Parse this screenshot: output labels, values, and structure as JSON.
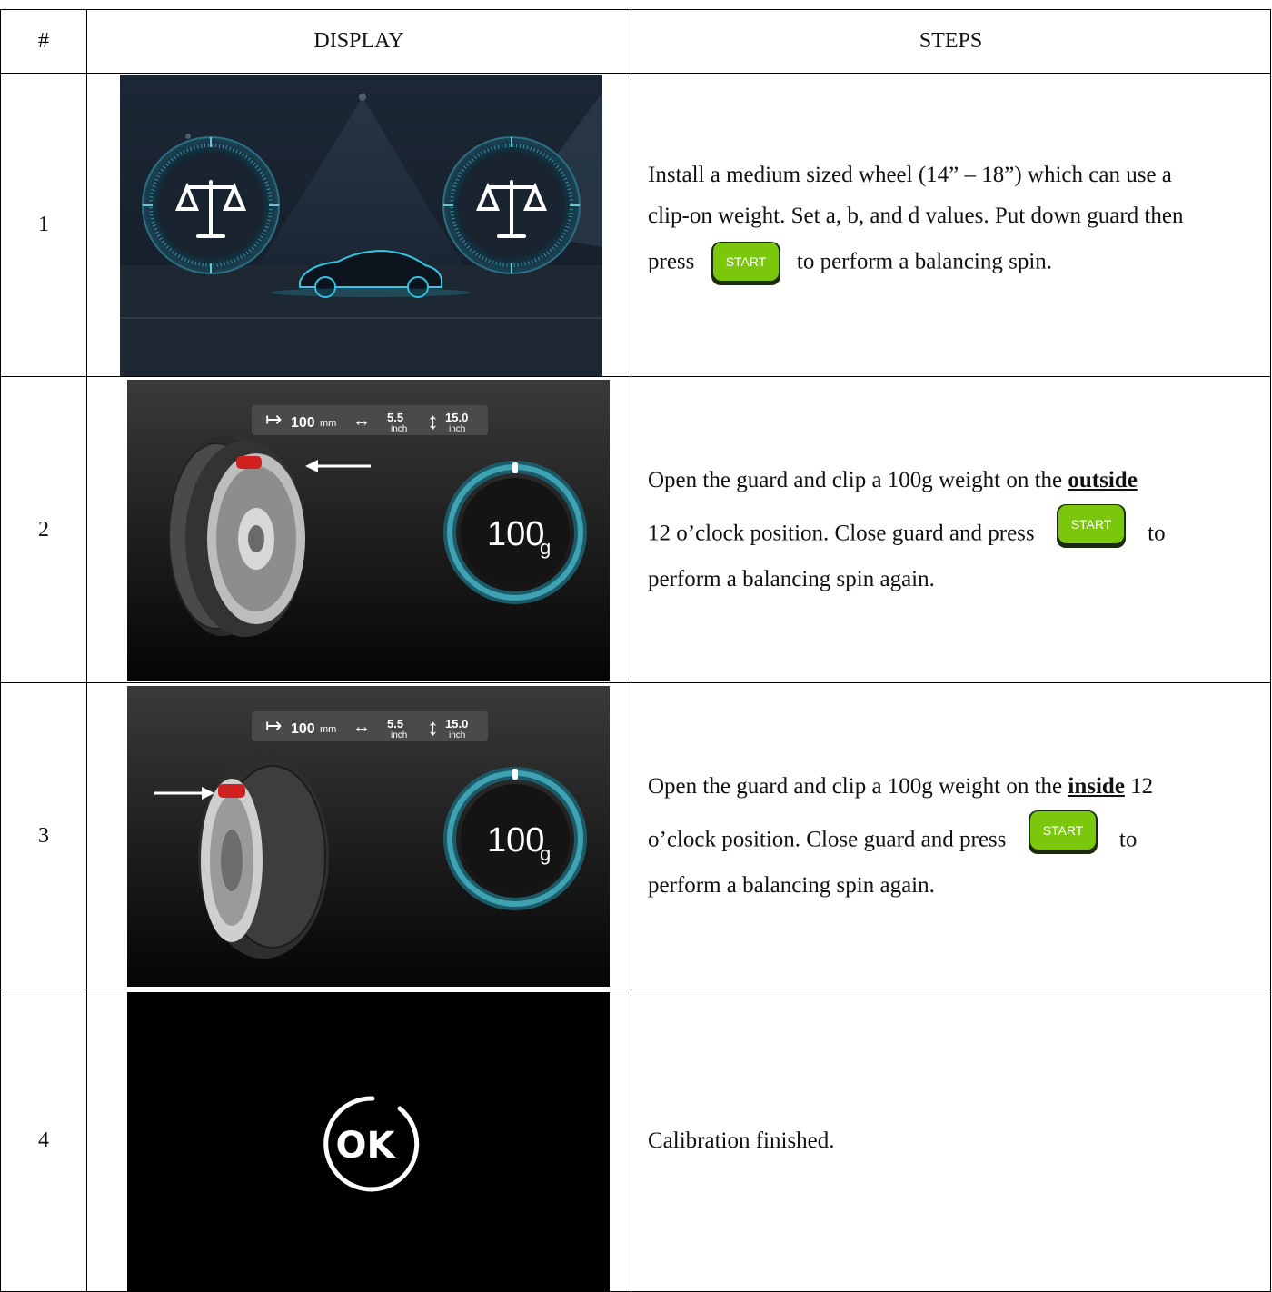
{
  "table": {
    "headers": [
      "#",
      "DISPLAY",
      "STEPS"
    ],
    "rows": [
      {
        "num": "1",
        "steps": {
          "line1": "Install a medium sized wheel (14” – 18”) which can use a",
          "line2": "clip-on weight. Set a, b, and d values. Put down guard then",
          "line3_pre": "press",
          "line3_post": "to perform a balancing spin."
        }
      },
      {
        "num": "2",
        "display": {
          "dim_a": "100",
          "dim_a_unit": "mm",
          "dim_b": "5.5",
          "dim_b_unit": "inch",
          "dim_d": "15.0",
          "dim_d_unit": "inch",
          "weight": "100",
          "weight_unit": "g"
        },
        "steps": {
          "line1_pre": "Open the guard and clip a 100g weight on the ",
          "line1_em": "outside",
          "line2_pre": "12 o’clock position. Close guard and press",
          "line2_post": "to",
          "line3": "perform a balancing spin again."
        }
      },
      {
        "num": "3",
        "display": {
          "dim_a": "100",
          "dim_a_unit": "mm",
          "dim_b": "5.5",
          "dim_b_unit": "inch",
          "dim_d": "15.0",
          "dim_d_unit": "inch",
          "weight": "100",
          "weight_unit": "g"
        },
        "steps": {
          "line1_pre": "Open the guard and clip a 100g weight on the ",
          "line1_em": "inside",
          "line1_post": " 12",
          "line2_pre": "o’clock position. Close guard and press",
          "line2_post": "to",
          "line3": "perform a balancing spin again."
        }
      },
      {
        "num": "4",
        "display": {
          "ok_text": "OK"
        },
        "steps": {
          "line1": "Calibration finished."
        }
      }
    ]
  },
  "start_button": {
    "label": "START",
    "color": "#7ac70c"
  },
  "colors": {
    "ring": "#3fb7c8",
    "panel_dark": "#15202c",
    "arrow": "#ffffff"
  }
}
